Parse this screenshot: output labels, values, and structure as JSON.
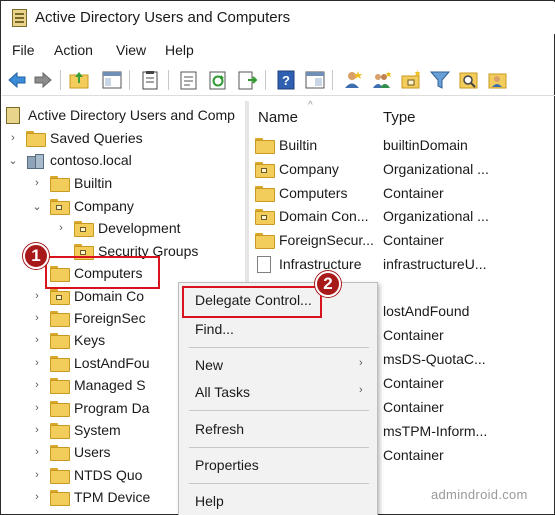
{
  "window": {
    "title": "Active Directory Users and Computers"
  },
  "menubar": {
    "items": [
      "File",
      "Action",
      "View",
      "Help"
    ]
  },
  "toolbar": {
    "icons": [
      "back-arrow-icon",
      "forward-arrow-icon",
      "up-folder-icon",
      "show-hide-tree-icon",
      "clipboard-icon",
      "properties-icon",
      "refresh-icon",
      "export-list-icon",
      "help-icon",
      "console-icon",
      "new-user-icon",
      "new-group-icon",
      "new-ou-icon",
      "filter-icon",
      "find-icon",
      "add-to-group-icon"
    ]
  },
  "tree": {
    "root_label": "Active Directory Users and Comp",
    "saved_queries": "Saved Queries",
    "domain": "contoso.local",
    "builtin": "Builtin",
    "company": "Company",
    "development": "Development",
    "security_groups": "Security Groups",
    "computers": "Computers",
    "domain_co": "Domain Co",
    "foreignsec": "ForeignSec",
    "keys": "Keys",
    "lostandfound": "LostAndFou",
    "managed": "Managed S",
    "program_da": "Program Da",
    "system": "System",
    "users": "Users",
    "ntds_quo": "NTDS Quo",
    "tpm_device": "TPM Device"
  },
  "list": {
    "headers": {
      "name": "Name",
      "type": "Type"
    },
    "rows": [
      {
        "name": "Builtin",
        "type": "builtinDomain"
      },
      {
        "name": "Company",
        "type": "Organizational ..."
      },
      {
        "name": "Computers",
        "type": "Container"
      },
      {
        "name": "Domain Con...",
        "type": "Organizational ..."
      },
      {
        "name": "ForeignSecur...",
        "type": "Container"
      },
      {
        "name": "Infrastructure",
        "type": "infrastructureU..."
      },
      {
        "name": "",
        "type": "lostAndFound"
      },
      {
        "name": "",
        "type": "Container"
      },
      {
        "name": "",
        "type": "msDS-QuotaC..."
      },
      {
        "name": "",
        "type": "Container"
      },
      {
        "name": "",
        "type": "Container"
      },
      {
        "name": "",
        "type": "msTPM-Inform..."
      },
      {
        "name": "",
        "type": "Container"
      }
    ]
  },
  "context_menu": {
    "delegate": "Delegate Control...",
    "find": "Find...",
    "new": "New",
    "all_tasks": "All Tasks",
    "refresh": "Refresh",
    "properties": "Properties",
    "help": "Help"
  },
  "callouts": {
    "one": "1",
    "two": "2"
  },
  "watermark": "admindroid.com",
  "colors": {
    "annotation_red": "#d9131b",
    "callout_fill": "#a8191a",
    "folder_yellow": "#f2cd5c"
  }
}
